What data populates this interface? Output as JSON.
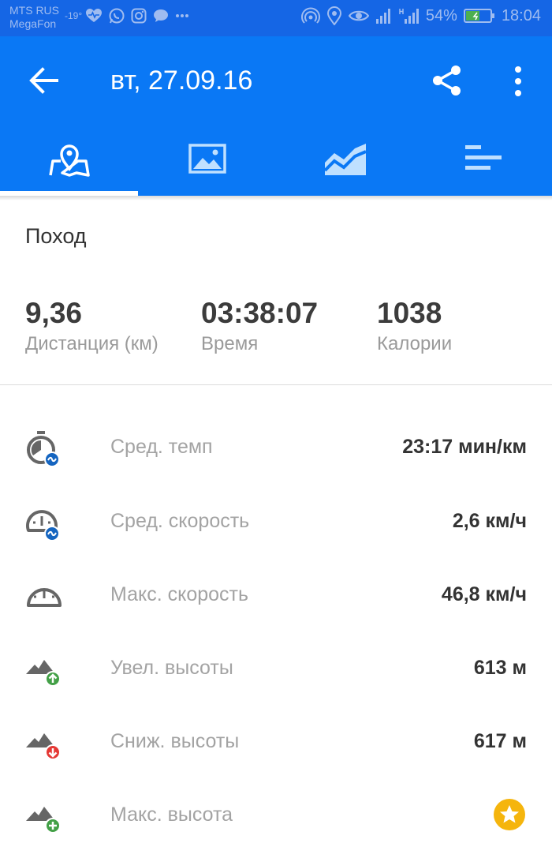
{
  "status_bar": {
    "carrier1": "MTS RUS",
    "carrier2": "MegaFon",
    "temperature": "-19°",
    "battery": "54%",
    "time": "18:04"
  },
  "app_bar": {
    "title": "вт, 27.09.16"
  },
  "tabs": [
    {
      "icon": "map-icon",
      "active": true
    },
    {
      "icon": "image-icon",
      "active": false
    },
    {
      "icon": "chart-icon",
      "active": false
    },
    {
      "icon": "list-icon",
      "active": false
    }
  ],
  "activity_type": "Поход",
  "summary": [
    {
      "value": "9,36",
      "label": "Дистанция (км)"
    },
    {
      "value": "03:38:07",
      "label": "Время"
    },
    {
      "value": "1038",
      "label": "Калории"
    }
  ],
  "stats": [
    {
      "icon": "avg-pace-icon",
      "label": "Сред. темп",
      "value": "23:17 мин/км"
    },
    {
      "icon": "avg-speed-icon",
      "label": "Сред. скорость",
      "value": "2,6 км/ч"
    },
    {
      "icon": "max-speed-icon",
      "label": "Макс. скорость",
      "value": "46,8 км/ч"
    },
    {
      "icon": "elevation-gain-icon",
      "label": "Увел. высоты",
      "value": "613 м"
    },
    {
      "icon": "elevation-loss-icon",
      "label": "Сниж. высоты",
      "value": "617 м"
    },
    {
      "icon": "max-elevation-icon",
      "label": "Макс. высота",
      "value": ""
    }
  ],
  "colors": {
    "app_bar": "#0a78f5",
    "status_bar": "#1566e5",
    "badge_blue": "#1565c0",
    "badge_green": "#43a047",
    "badge_red": "#e53935",
    "star": "#f5b50d"
  }
}
